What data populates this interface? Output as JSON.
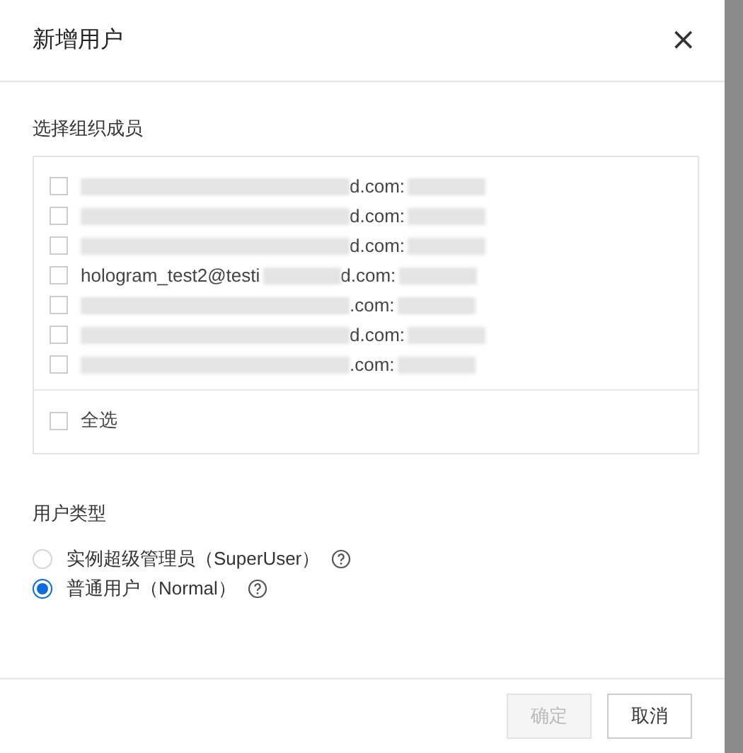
{
  "dialog": {
    "title": "新增用户",
    "close": "×"
  },
  "members": {
    "label": "选择组织成员",
    "items": [
      {
        "text": "d.com:",
        "checked": false
      },
      {
        "text": "d.com:",
        "checked": false
      },
      {
        "text": "d.com:",
        "checked": false
      },
      {
        "before": "hologram_test2@testi",
        "text": "d.com:",
        "checked": false
      },
      {
        "text": ".com:",
        "checked": false
      },
      {
        "text": "d.com:",
        "checked": false
      },
      {
        "text": ".com:",
        "checked": false
      }
    ],
    "select_all": {
      "label": "全选",
      "checked": false
    }
  },
  "user_type": {
    "label": "用户类型",
    "options": [
      {
        "label": "实例超级管理员（SuperUser）",
        "selected": false
      },
      {
        "label": "普通用户（Normal）",
        "selected": true
      }
    ]
  },
  "buttons": [
    {
      "label": "确定",
      "disabled": true
    },
    {
      "label": "取消",
      "disabled": false
    }
  ]
}
